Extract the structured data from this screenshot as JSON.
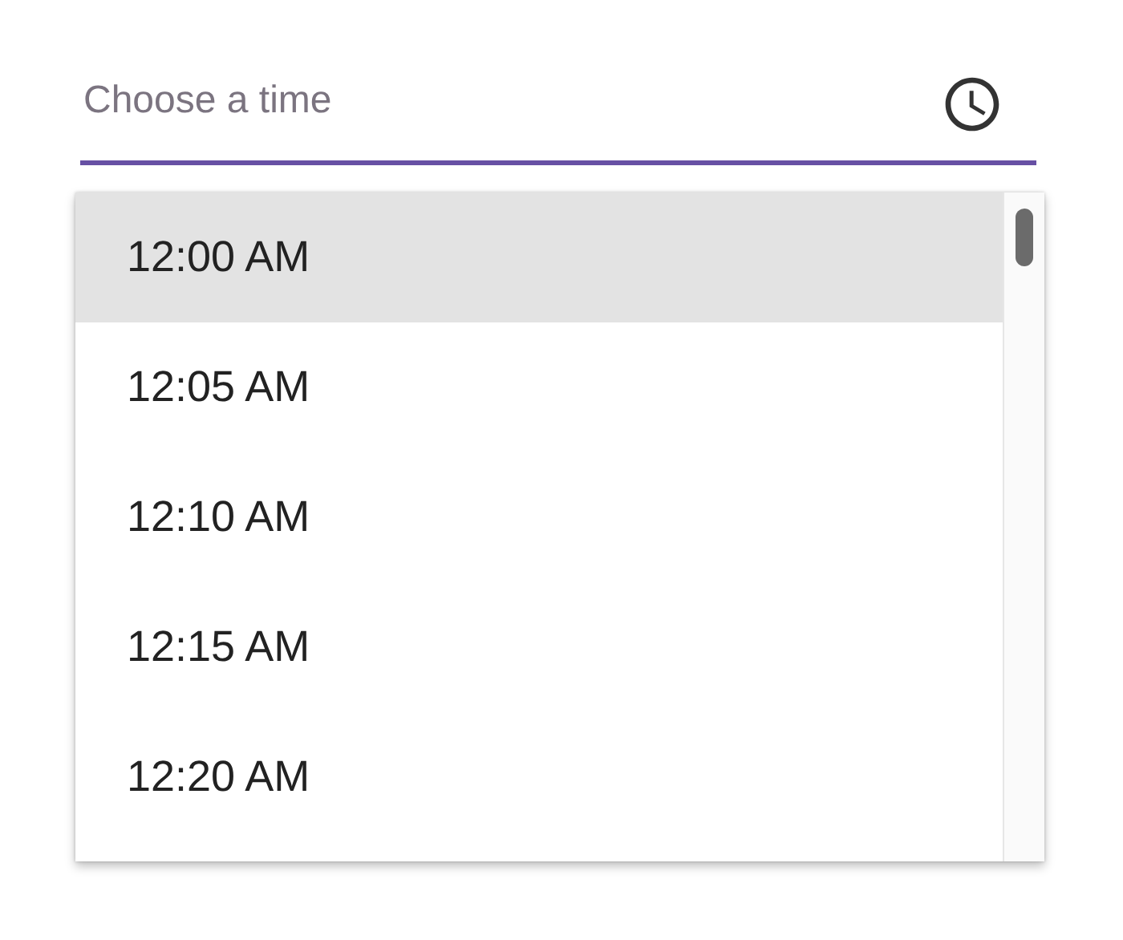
{
  "time_field": {
    "placeholder": "Choose a time",
    "focused": true
  },
  "options": [
    {
      "label": "12:00 AM",
      "selected": true
    },
    {
      "label": "12:05 AM",
      "selected": false
    },
    {
      "label": "12:10 AM",
      "selected": false
    },
    {
      "label": "12:15 AM",
      "selected": false
    },
    {
      "label": "12:20 AM",
      "selected": false
    }
  ]
}
